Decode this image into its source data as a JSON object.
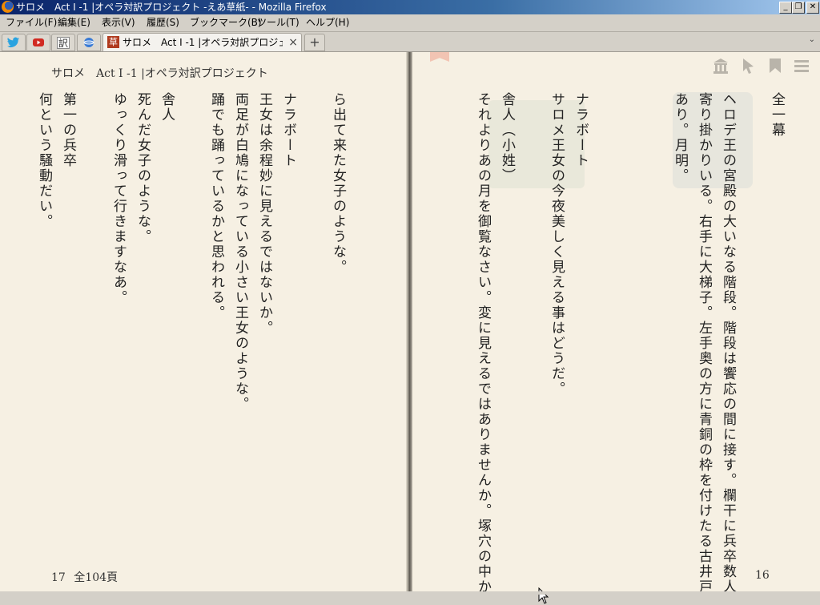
{
  "window": {
    "title": "サロメ　Act I -1 |オペラ対訳プロジェクト -えあ草紙- - Mozilla Firefox"
  },
  "menu": [
    "ファイル(F)",
    "編集(E)",
    "表示(V)",
    "履歴(S)",
    "ブックマーク(B)",
    "ツール(T)",
    "ヘルプ(H)"
  ],
  "app_tabs": [
    {
      "icon": "twitter-icon",
      "color": "#2aa3e0"
    },
    {
      "icon": "youtube-icon",
      "color": "#d12a22"
    },
    {
      "icon": "translate-icon",
      "label": "訳"
    },
    {
      "icon": "globe-icon",
      "color": "#3a7bd5"
    }
  ],
  "tab": {
    "icon_char": "草",
    "label": "サロメ　Act I -1 |オペラ対訳プロジェクト -…",
    "close": "×"
  },
  "new_tab": "+",
  "left_page": {
    "running_head": "サロメ　Act I -1 |オペラ対訳プロジェクト",
    "page_number": "17",
    "total_pages": "全104頁",
    "lines": [
      "ら出て来た女子のような。",
      "",
      "ナラボート",
      "王女は余程妙に見えるではないか。",
      "両足が白鳩になっている小さい王女のような。",
      "踊でも踊っているかと思われる。",
      "",
      "舎人",
      "死んだ女子のような。",
      "ゆっくり滑って行きますなあ。",
      "",
      "第一の兵卒",
      "何という騒動だい。"
    ]
  },
  "right_page": {
    "page_number": "16",
    "lines": [
      "全一幕",
      "ヘロデ王の宮殿の大いなる階段。階段は饗応の間に接す。欄干に兵卒数人",
      "寄り掛かりいる。右手に大梯子。左手奥の方に青銅の枠を付けたる古井戸",
      "あり。月明。",
      "",
      "ナラボート",
      "サロメ王女の今夜美しく見える事はどうだ。",
      "",
      "舎人（小姓）",
      "それよりあの月を御覧なさい。変に見えるではありませんか。塚穴の中か"
    ]
  },
  "toolbar_icons": [
    "library-icon",
    "pointer-icon",
    "bookmark-icon",
    "menu-icon"
  ]
}
